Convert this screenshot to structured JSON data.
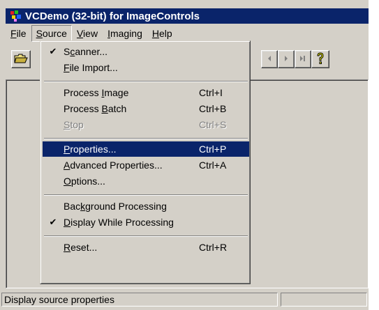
{
  "window": {
    "title": "VCDemo (32-bit) for ImageControls"
  },
  "menubar": {
    "items": [
      {
        "pre": "",
        "u": "F",
        "post": "ile"
      },
      {
        "pre": "",
        "u": "S",
        "post": "ource"
      },
      {
        "pre": "",
        "u": "V",
        "post": "iew"
      },
      {
        "pre": "",
        "u": "I",
        "post": "maging"
      },
      {
        "pre": "",
        "u": "H",
        "post": "elp"
      }
    ]
  },
  "source_menu": {
    "scanner": {
      "pre": "S",
      "u": "c",
      "post": "anner...",
      "accel": "",
      "checked": true
    },
    "file_import": {
      "pre": "",
      "u": "F",
      "post": "ile Import...",
      "accel": ""
    },
    "process_image": {
      "pre": "Process ",
      "u": "I",
      "post": "mage",
      "accel": "Ctrl+I"
    },
    "process_batch": {
      "pre": "Process ",
      "u": "B",
      "post": "atch",
      "accel": "Ctrl+B"
    },
    "stop": {
      "pre": "",
      "u": "S",
      "post": "top",
      "accel": "Ctrl+S",
      "disabled": true
    },
    "properties": {
      "pre": "",
      "u": "P",
      "post": "roperties...",
      "accel": "Ctrl+P",
      "highlighted": true
    },
    "advanced_properties": {
      "pre": "",
      "u": "A",
      "post": "dvanced Properties...",
      "accel": "Ctrl+A"
    },
    "options": {
      "pre": "",
      "u": "O",
      "post": "ptions...",
      "accel": ""
    },
    "background_processing": {
      "pre": "Bac",
      "u": "k",
      "post": "ground Processing",
      "accel": ""
    },
    "display_while_processing": {
      "pre": "",
      "u": "D",
      "post": "isplay While Processing",
      "accel": "",
      "checked": true
    },
    "reset": {
      "pre": "",
      "u": "R",
      "post": "eset...",
      "accel": "Ctrl+R"
    },
    "check_glyph": "✔"
  },
  "statusbar": {
    "message": "Display source properties"
  },
  "icons": {
    "app": "app-icon",
    "open": "open-folder-icon",
    "prev": "previous-icon",
    "next": "next-icon",
    "last": "last-icon",
    "help": "help-icon"
  },
  "colors": {
    "title_bar": "#0a246a",
    "face": "#d4d0c8",
    "highlight": "#0a246a"
  }
}
